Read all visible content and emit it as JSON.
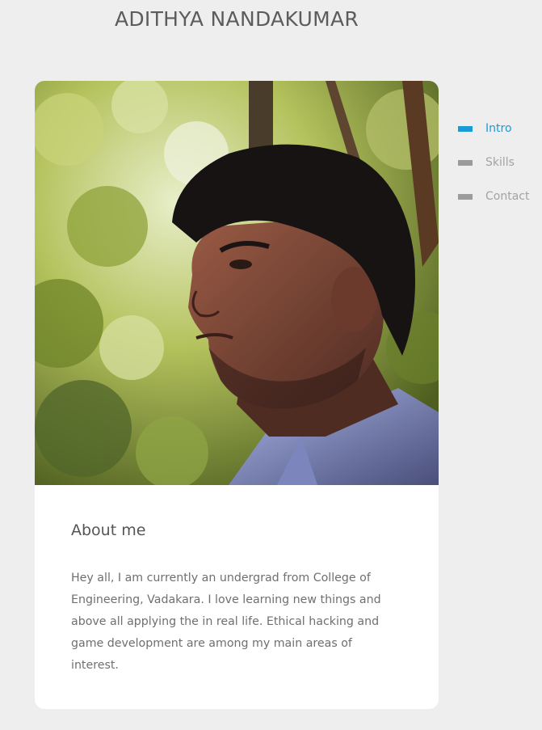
{
  "header": {
    "title": "ADITHYA NANDAKUMAR"
  },
  "card": {
    "photo_icon": "portrait-photo",
    "about_heading": "About me",
    "about_text": "Hey all, I am currently an undergrad from College of Engineering, Vadakara. I love learning new things and above all applying the in real life. Ethical hacking and game development are among my main areas of interest."
  },
  "nav": {
    "items": [
      {
        "label": "Intro",
        "active": true
      },
      {
        "label": "Skills",
        "active": false
      },
      {
        "label": "Contact",
        "active": false
      }
    ]
  },
  "colors": {
    "background": "#eeeeee",
    "card": "#ffffff",
    "accent": "#1a9bd7",
    "inactive": "#9b9b9b",
    "title_text": "#5c5c5c"
  }
}
